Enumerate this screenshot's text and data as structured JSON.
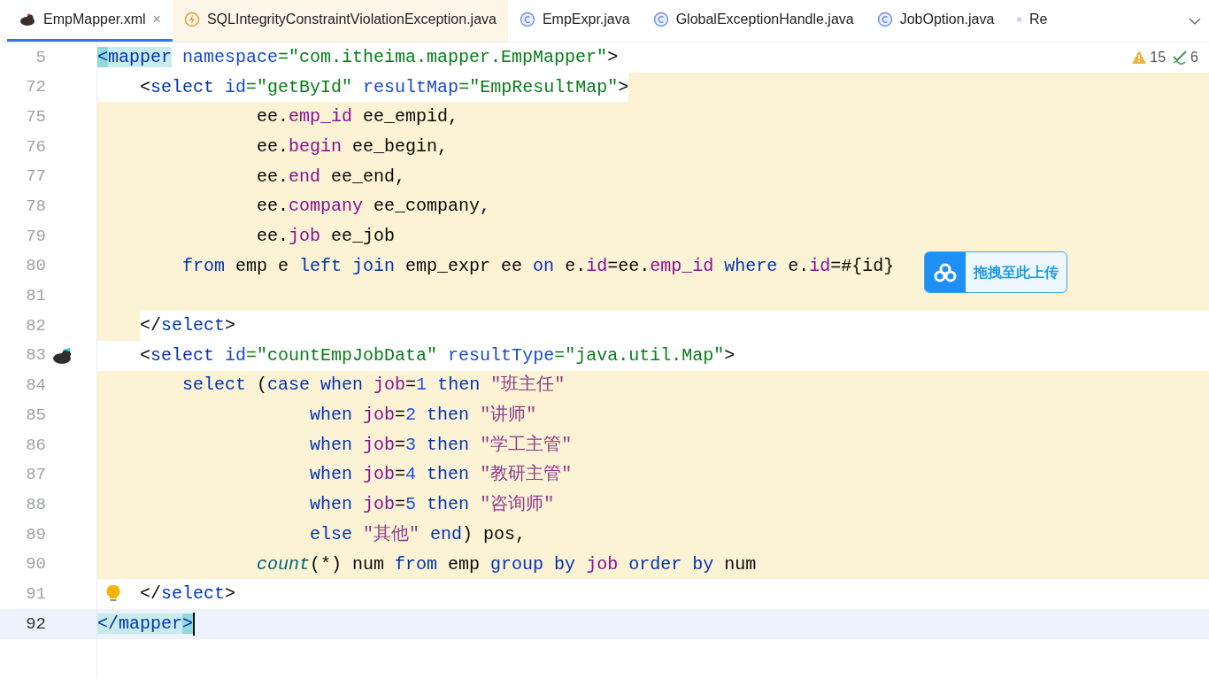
{
  "tabs": [
    {
      "label": "EmpMapper.xml",
      "kind": "xml",
      "selected": true,
      "close": "×"
    },
    {
      "label": "SQLIntegrityConstraintViolationException.java",
      "kind": "exception",
      "selected": false
    },
    {
      "label": "EmpExpr.java",
      "kind": "class",
      "selected": false
    },
    {
      "label": "GlobalExceptionHandle.java",
      "kind": "class",
      "selected": false
    },
    {
      "label": "JobOption.java",
      "kind": "class",
      "selected": false
    },
    {
      "label": "Re",
      "kind": "class",
      "selected": false
    }
  ],
  "inspections": {
    "warnings": "15",
    "checks": "6"
  },
  "upload_badge": {
    "label": "拖拽至此上传"
  },
  "lines": [
    {
      "number": "5",
      "kind": "none",
      "tokens": [
        {
          "kind": "bracematch",
          "t": "<"
        },
        {
          "kind": "tagmatch",
          "t": "mapper"
        },
        {
          "kind": "attr",
          "t": " namespace"
        },
        {
          "kind": "str",
          "t": "=\"com.itheima.mapper.EmpMapper\""
        },
        {
          "kind": "plain",
          "t": ">"
        }
      ]
    },
    {
      "number": "72",
      "kind": "tail",
      "tokens": [
        {
          "kind": "plain",
          "t": "    <"
        },
        {
          "kind": "tag",
          "t": "select"
        },
        {
          "kind": "attr",
          "t": " id"
        },
        {
          "kind": "str",
          "t": "=\"getById\""
        },
        {
          "kind": "attr",
          "t": " resultMap"
        },
        {
          "kind": "str",
          "t": "=\"EmpResultMap\""
        },
        {
          "kind": "plain",
          "t": ">"
        }
      ]
    },
    {
      "number": "75",
      "kind": "full",
      "tokens": [
        {
          "kind": "plain",
          "t": "               ee."
        },
        {
          "kind": "field",
          "t": "emp_id"
        },
        {
          "kind": "plain",
          "t": " ee_empid,"
        }
      ]
    },
    {
      "number": "76",
      "kind": "full",
      "tokens": [
        {
          "kind": "plain",
          "t": "               ee."
        },
        {
          "kind": "field",
          "t": "begin"
        },
        {
          "kind": "plain",
          "t": " ee_begin,"
        }
      ]
    },
    {
      "number": "77",
      "kind": "full",
      "tokens": [
        {
          "kind": "plain",
          "t": "               ee."
        },
        {
          "kind": "field",
          "t": "end"
        },
        {
          "kind": "plain",
          "t": " ee_end,"
        }
      ]
    },
    {
      "number": "78",
      "kind": "full",
      "tokens": [
        {
          "kind": "plain",
          "t": "               ee."
        },
        {
          "kind": "field",
          "t": "company"
        },
        {
          "kind": "plain",
          "t": " ee_company,"
        }
      ]
    },
    {
      "number": "79",
      "kind": "full",
      "tokens": [
        {
          "kind": "plain",
          "t": "               ee."
        },
        {
          "kind": "field",
          "t": "job"
        },
        {
          "kind": "plain",
          "t": " ee_job"
        }
      ]
    },
    {
      "number": "80",
      "kind": "full",
      "tokens": [
        {
          "kind": "keyword",
          "t": "        from"
        },
        {
          "kind": "plain",
          "t": " emp e"
        },
        {
          "kind": "keyword",
          "t": " left join"
        },
        {
          "kind": "plain",
          "t": " emp_expr ee"
        },
        {
          "kind": "keyword",
          "t": " on"
        },
        {
          "kind": "plain",
          "t": " e."
        },
        {
          "kind": "field",
          "t": "id"
        },
        {
          "kind": "plain",
          "t": "=ee."
        },
        {
          "kind": "field",
          "t": "emp_id"
        },
        {
          "kind": "keyword",
          "t": " where"
        },
        {
          "kind": "plain",
          "t": " e."
        },
        {
          "kind": "field",
          "t": "id"
        },
        {
          "kind": "plain",
          "t": "=#{id}"
        }
      ]
    },
    {
      "number": "81",
      "kind": "full"
    },
    {
      "number": "82",
      "kind": "indent",
      "tokens": [
        {
          "kind": "plain",
          "t": "    </"
        },
        {
          "kind": "tag",
          "t": "select"
        },
        {
          "kind": "plain",
          "t": ">"
        }
      ]
    },
    {
      "number": "83",
      "kind": "none",
      "gutter_icon": true,
      "tokens": [
        {
          "kind": "plain",
          "t": "    <"
        },
        {
          "kind": "tag",
          "t": "select"
        },
        {
          "kind": "attr",
          "t": " id"
        },
        {
          "kind": "str",
          "t": "=\"countEmpJobData\""
        },
        {
          "kind": "attr",
          "t": " resultType"
        },
        {
          "kind": "str",
          "t": "=\"java.util.Map\""
        },
        {
          "kind": "plain",
          "t": ">"
        }
      ]
    },
    {
      "number": "84",
      "kind": "full",
      "tokens": [
        {
          "kind": "keyword",
          "t": "        select"
        },
        {
          "kind": "plain",
          "t": " ("
        },
        {
          "kind": "keyword",
          "t": "case when"
        },
        {
          "kind": "field",
          "t": " job"
        },
        {
          "kind": "plain",
          "t": "="
        },
        {
          "kind": "number",
          "t": "1"
        },
        {
          "kind": "keyword",
          "t": " then"
        },
        {
          "kind": "sqlstring",
          "t": " \"班主任\""
        }
      ]
    },
    {
      "number": "85",
      "kind": "full",
      "tokens": [
        {
          "kind": "keyword",
          "t": "                    when"
        },
        {
          "kind": "field",
          "t": " job"
        },
        {
          "kind": "plain",
          "t": "="
        },
        {
          "kind": "number",
          "t": "2"
        },
        {
          "kind": "keyword",
          "t": " then"
        },
        {
          "kind": "sqlstring",
          "t": " \"讲师\""
        }
      ]
    },
    {
      "number": "86",
      "kind": "full",
      "tokens": [
        {
          "kind": "keyword",
          "t": "                    when"
        },
        {
          "kind": "field",
          "t": " job"
        },
        {
          "kind": "plain",
          "t": "="
        },
        {
          "kind": "number",
          "t": "3"
        },
        {
          "kind": "keyword",
          "t": " then"
        },
        {
          "kind": "sqlstring",
          "t": " \"学工主管\""
        }
      ]
    },
    {
      "number": "87",
      "kind": "full",
      "tokens": [
        {
          "kind": "keyword",
          "t": "                    when"
        },
        {
          "kind": "field",
          "t": " job"
        },
        {
          "kind": "plain",
          "t": "="
        },
        {
          "kind": "number",
          "t": "4"
        },
        {
          "kind": "keyword",
          "t": " then"
        },
        {
          "kind": "sqlstring",
          "t": " \"教研主管\""
        }
      ]
    },
    {
      "number": "88",
      "kind": "full",
      "tokens": [
        {
          "kind": "keyword",
          "t": "                    when"
        },
        {
          "kind": "field",
          "t": " job"
        },
        {
          "kind": "plain",
          "t": "="
        },
        {
          "kind": "number",
          "t": "5"
        },
        {
          "kind": "keyword",
          "t": " then"
        },
        {
          "kind": "sqlstring",
          "t": " \"咨询师\""
        }
      ]
    },
    {
      "number": "89",
      "kind": "full",
      "tokens": [
        {
          "kind": "keyword",
          "t": "                    else"
        },
        {
          "kind": "sqlstring",
          "t": " \"其他\""
        },
        {
          "kind": "keyword",
          "t": " end"
        },
        {
          "kind": "plain",
          "t": ") pos,"
        }
      ]
    },
    {
      "number": "90",
      "kind": "full",
      "tokens": [
        {
          "kind": "function",
          "t": "               count"
        },
        {
          "kind": "plain",
          "t": "(*) num"
        },
        {
          "kind": "keyword",
          "t": " from"
        },
        {
          "kind": "plain",
          "t": " emp"
        },
        {
          "kind": "keyword",
          "t": " group by"
        },
        {
          "kind": "field",
          "t": " job"
        },
        {
          "kind": "keyword",
          "t": " order by"
        },
        {
          "kind": "plain",
          "t": " num"
        }
      ]
    },
    {
      "number": "91",
      "kind": "none",
      "bulb": true,
      "tokens": [
        {
          "kind": "plain",
          "t": "    </"
        },
        {
          "kind": "tag",
          "t": "select"
        },
        {
          "kind": "plain",
          "t": ">"
        }
      ]
    },
    {
      "number": "92",
      "kind": "current",
      "caret": true,
      "tokens": [
        {
          "kind": "tagmatch",
          "t": "</mapper"
        },
        {
          "kind": "bracematch",
          "t": ">"
        }
      ]
    }
  ]
}
